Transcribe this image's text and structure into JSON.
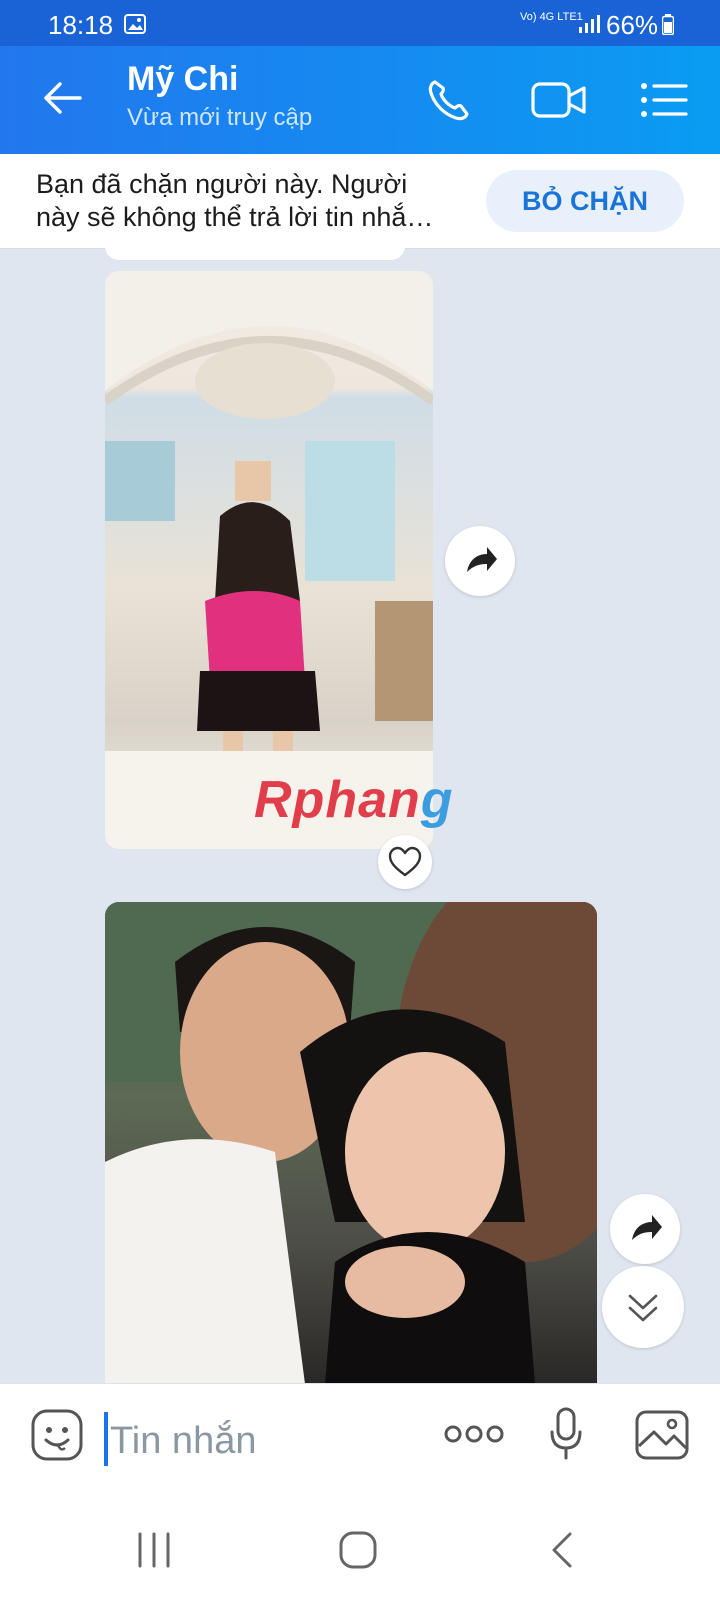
{
  "status_bar": {
    "time": "18:18",
    "network_label": "Vo) 4G LTE1",
    "battery": "66%"
  },
  "header": {
    "name": "Mỹ Chi",
    "subtitle": "Vừa mới truy cập",
    "icons": [
      "back-arrow-icon",
      "phone-icon",
      "video-camera-icon",
      "menu-list-icon"
    ]
  },
  "block_banner": {
    "message": "Bạn đã chặn người này. Người này sẽ không thể trả lời tin nhắ…",
    "unblock_label": "BỎ CHẶN"
  },
  "watermark": {
    "part1": "Rphan",
    "part2": "g"
  },
  "composer": {
    "placeholder": "Tin nhắn"
  },
  "colors": {
    "header_start": "#2277ee",
    "header_end": "#0a9cf3",
    "chat_background": "#dfe6ef",
    "accent": "#1a73d6"
  }
}
